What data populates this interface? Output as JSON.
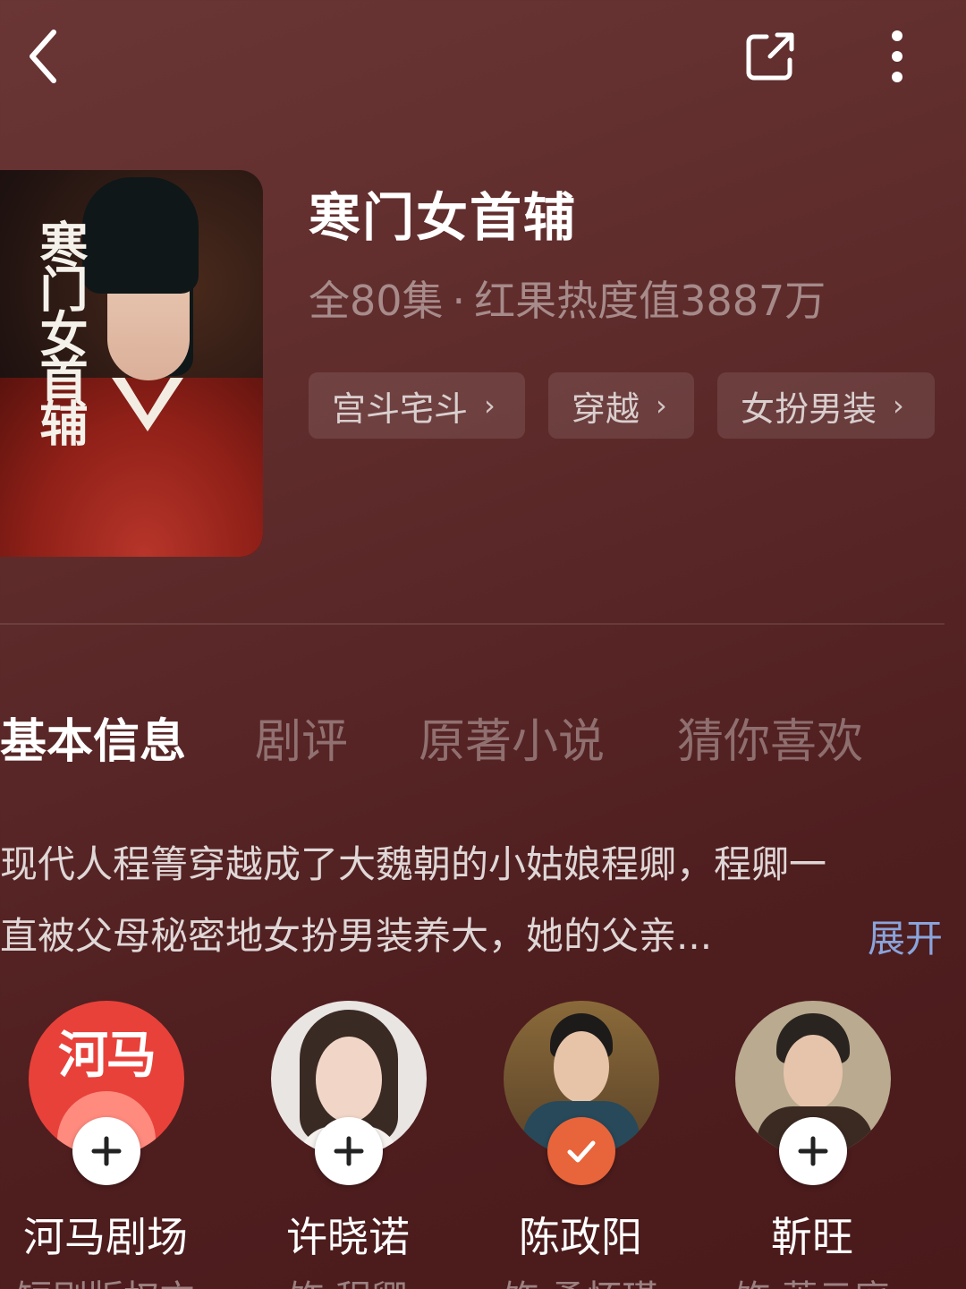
{
  "header": {
    "back_icon": "chevron-left-icon",
    "share_icon": "share-icon",
    "more_icon": "more-vertical-icon"
  },
  "poster": {
    "calligraphy": "寒门女首辅",
    "gallery_icon": "gallery-icon"
  },
  "show": {
    "title": "寒门女首辅",
    "episodes": "全80集",
    "separator": "·",
    "heat": "红果热度值3887万"
  },
  "tags": [
    {
      "label": "宫斗宅斗"
    },
    {
      "label": "穿越"
    },
    {
      "label": "女扮男装"
    }
  ],
  "tabs": [
    {
      "label": "基本信息",
      "active": true
    },
    {
      "label": "剧评"
    },
    {
      "label": "原著小说"
    },
    {
      "label": "猜你喜欢"
    }
  ],
  "synopsis": {
    "line1": "现代人程箐穿越成了大魏朝的小姑娘程卿，程卿一",
    "line2": "直被父母秘密地女扮男装养大，她的父亲...",
    "expand_label": "展开"
  },
  "cast": [
    {
      "name": "河马剧场",
      "role": "短剧版权方",
      "avatar_text": "河马",
      "followed": false
    },
    {
      "name": "许晓诺",
      "role": "饰 程卿",
      "followed": false
    },
    {
      "name": "陈政阳",
      "role": "饰 柔怀瑾",
      "followed": true
    },
    {
      "name": "靳旺",
      "role": "饰 萧云庭",
      "followed": false
    }
  ],
  "colors": {
    "background": "#5e2b2b",
    "accent_link": "#8aa4dc",
    "followed_badge": "#e8643a"
  }
}
